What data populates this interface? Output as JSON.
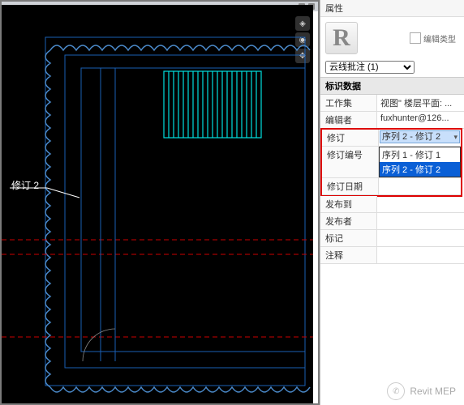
{
  "props": {
    "panel_title": "属性",
    "type_selector": "云线批注 (1)",
    "edit_type_label": "编辑类型",
    "section_identity": "标识数据",
    "rows": {
      "workset_k": "工作集",
      "workset_v": "视图\" 楼层平面: ...",
      "editor_k": "编辑者",
      "editor_v": "fuxhunter@126...",
      "revision_k": "修订",
      "revision_v": "序列 2 - 修订 2",
      "revnum_k": "修订编号",
      "revdate_k": "修订日期",
      "issuedto_k": "发布到",
      "issuedby_k": "发布者",
      "mark_k": "标记",
      "comment_k": "注释"
    },
    "dropdown": {
      "opt1": "序列 1 - 修订 1",
      "opt2": "序列 2 - 修订 2"
    }
  },
  "canvas": {
    "revision_label": "修订 2"
  },
  "watermark": {
    "text": "Revit MEP"
  }
}
